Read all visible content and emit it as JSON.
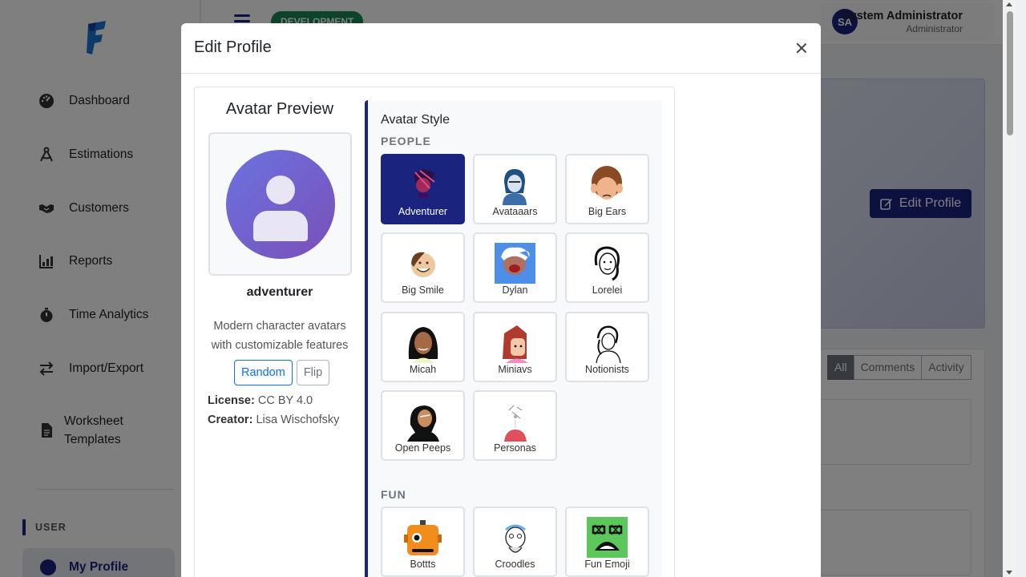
{
  "app": {
    "environment_badge": "DEVELOPMENT",
    "user": {
      "initials": "SA",
      "name": "System Administrator",
      "role": "Administrator"
    }
  },
  "sidebar": {
    "items": [
      {
        "label": "Dashboard",
        "icon": "speedometer-icon"
      },
      {
        "label": "Estimations",
        "icon": "drafting-compass-icon"
      },
      {
        "label": "Customers",
        "icon": "handshake-icon"
      },
      {
        "label": "Reports",
        "icon": "bar-chart-icon"
      },
      {
        "label": "Time Analytics",
        "icon": "stopwatch-icon"
      },
      {
        "label": "Import/Export",
        "icon": "arrows-swap-icon"
      },
      {
        "label": "Worksheet Templates",
        "icon": "document-icon"
      }
    ],
    "section_label": "USER",
    "active_item": "My Profile"
  },
  "page": {
    "edit_profile_button": "Edit Profile",
    "tabs": [
      "All",
      "Comments",
      "Activity"
    ],
    "active_tab": "All"
  },
  "modal": {
    "title": "Edit Profile",
    "preview": {
      "heading": "Avatar Preview",
      "style_name": "adventurer",
      "description": "Modern character avatars with customizable features",
      "random_label": "Random",
      "flip_label": "Flip",
      "license_label": "License:",
      "license_value": "CC BY 4.0",
      "creator_label": "Creator:",
      "creator_value": "Lisa Wischofsky"
    },
    "styles": {
      "heading": "Avatar Style",
      "selected": "Adventurer",
      "groups": [
        {
          "label": "PEOPLE",
          "items": [
            "Adventurer",
            "Avataaars",
            "Big Ears",
            "Big Smile",
            "Dylan",
            "Lorelei",
            "Micah",
            "Miniavs",
            "Notionists",
            "Open Peeps",
            "Personas"
          ]
        },
        {
          "label": "FUN",
          "items": [
            "Bottts",
            "Croodles",
            "Fun Emoji"
          ]
        }
      ]
    }
  },
  "colors": {
    "primary": "#1a237e",
    "backdrop": "rgba(0,0,0,0.5)",
    "preview_gradient": [
      "#6b73e0",
      "#7a4fb8"
    ],
    "dev_badge": "#198754"
  }
}
